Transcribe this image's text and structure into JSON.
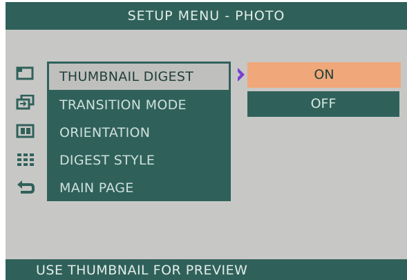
{
  "header": {
    "title": "SETUP MENU - PHOTO"
  },
  "menu": {
    "items": [
      {
        "label": "THUMBNAIL DIGEST",
        "icon": "thumbnail-icon"
      },
      {
        "label": "TRANSITION MODE",
        "icon": "transition-icon"
      },
      {
        "label": "ORIENTATION",
        "icon": "orientation-icon"
      },
      {
        "label": "DIGEST STYLE",
        "icon": "grid-icon"
      },
      {
        "label": "MAIN PAGE",
        "icon": "return-icon"
      }
    ],
    "selected_index": 0
  },
  "submenu": {
    "options": [
      {
        "label": "ON",
        "highlighted": true
      },
      {
        "label": "OFF",
        "highlighted": false
      }
    ]
  },
  "status": {
    "text": "USE THUMBNAIL FOR PREVIEW"
  },
  "colors": {
    "bar": "#2f615a",
    "background": "#c7c8c5",
    "highlight": "#f0a77a",
    "selected_item": "#bfc0bd",
    "arrow": "#7a3fd0"
  }
}
